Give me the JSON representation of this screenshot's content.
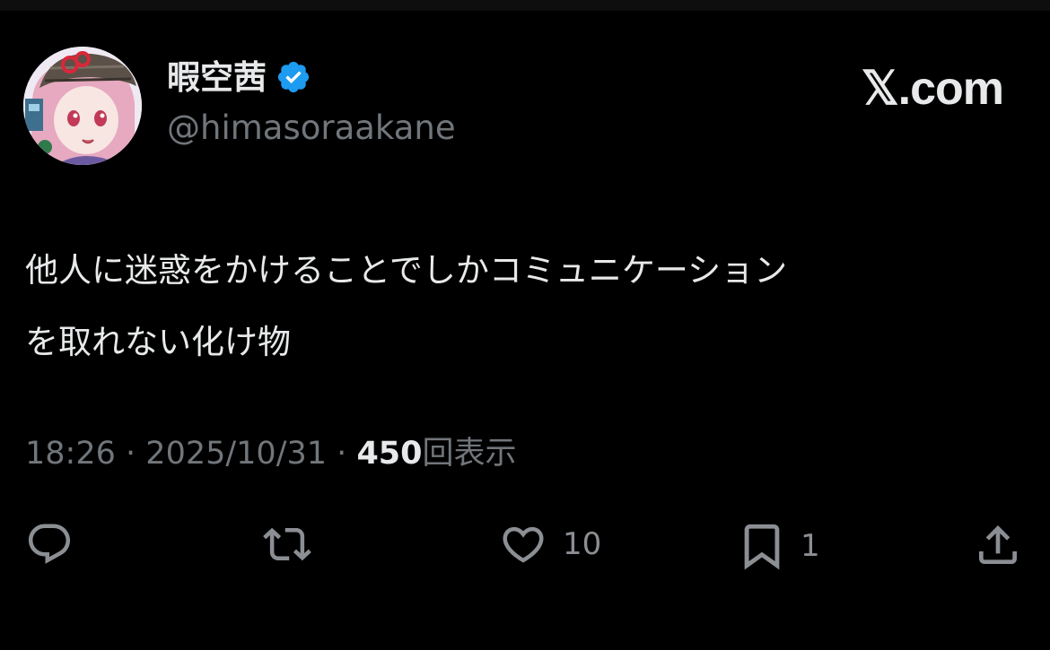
{
  "author": {
    "display_name": "暇空茜",
    "handle": "@himasoraakane",
    "verified": true
  },
  "brand": "𝕏.com",
  "tweet": {
    "lines": [
      "他人に迷惑をかけることでしかコミュニケーション",
      "を取れない化け物"
    ]
  },
  "meta": {
    "time": "18:26",
    "separator": "·",
    "date": "2025/10/31",
    "views_count": "450",
    "views_label": "回表示"
  },
  "actions": {
    "reply": {
      "icon": "reply-icon",
      "count": ""
    },
    "repost": {
      "icon": "repost-icon",
      "count": ""
    },
    "like": {
      "icon": "heart-icon",
      "count": "10"
    },
    "bookmark": {
      "icon": "bookmark-icon",
      "count": "1"
    },
    "share": {
      "icon": "share-icon",
      "count": ""
    }
  },
  "colors": {
    "background": "#000000",
    "text_primary": "#e7e9ea",
    "text_secondary": "#71767b",
    "verified_blue": "#1d9bf0"
  }
}
